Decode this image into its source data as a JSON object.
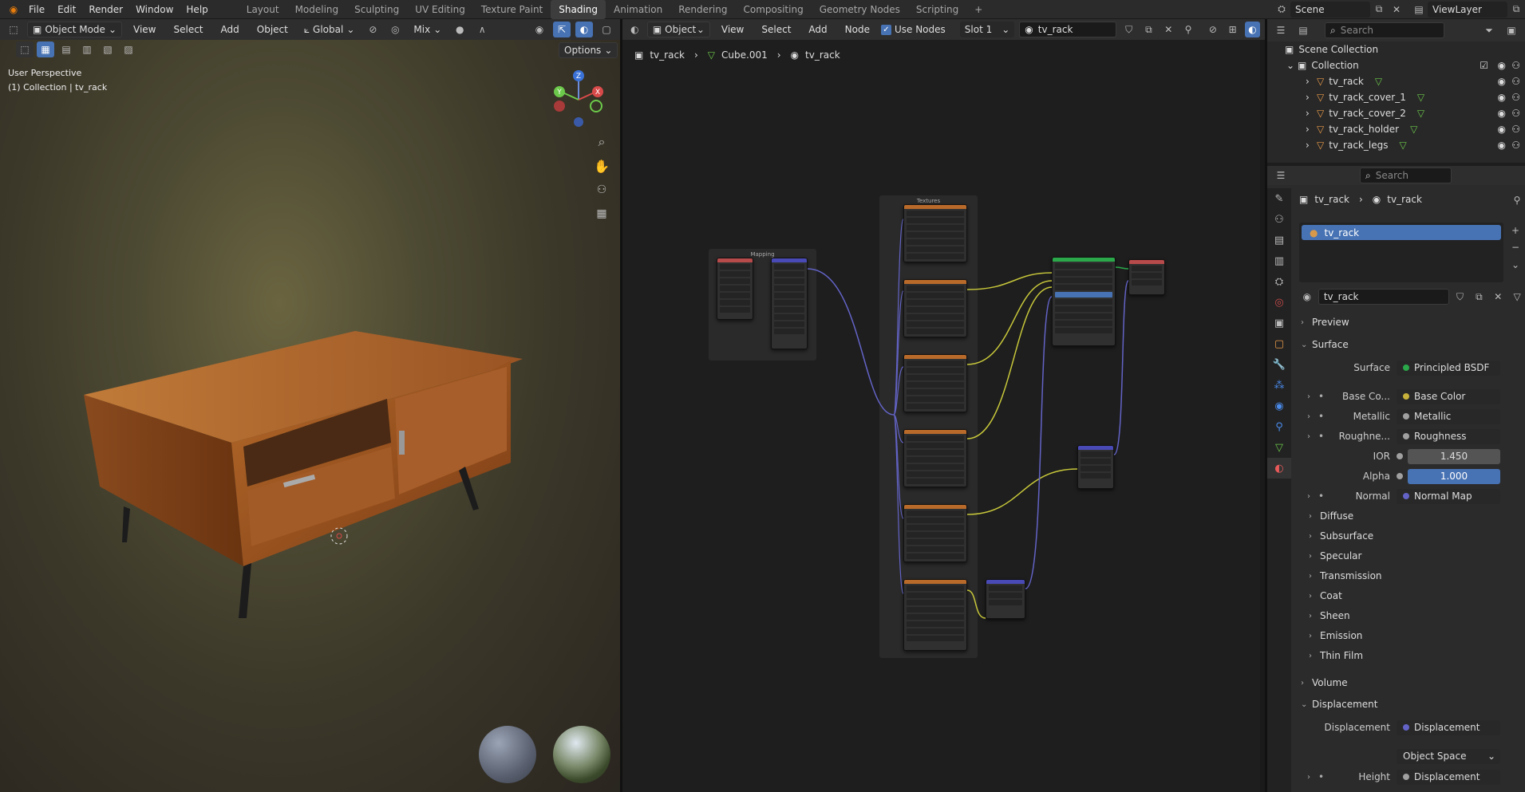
{
  "topbar": {
    "menus": [
      "File",
      "Edit",
      "Render",
      "Window",
      "Help"
    ],
    "workspaces": [
      "Layout",
      "Modeling",
      "Sculpting",
      "UV Editing",
      "Texture Paint",
      "Shading",
      "Animation",
      "Rendering",
      "Compositing",
      "Geometry Nodes",
      "Scripting"
    ],
    "active_workspace": "Shading",
    "add_tab": "+",
    "scene": "Scene",
    "view_layer": "ViewLayer"
  },
  "viewport": {
    "mode": "Object Mode",
    "menus": [
      "View",
      "Select",
      "Add",
      "Object"
    ],
    "transform": "Global",
    "pivot": "Mix",
    "options": "Options",
    "perspective": "User Perspective",
    "collection_info": "(1) Collection | tv_rack",
    "gizmo": {
      "x": "X",
      "y": "Y",
      "z": "Z"
    }
  },
  "node_editor": {
    "type": "Object",
    "menus": [
      "View",
      "Select",
      "Add",
      "Node"
    ],
    "use_nodes_label": "Use Nodes",
    "use_nodes": true,
    "slot": "Slot 1",
    "material": "tv_rack",
    "breadcrumb": [
      "tv_rack",
      "Cube.001",
      "tv_rack"
    ],
    "frames": {
      "mapping": "Mapping",
      "textures": "Textures"
    }
  },
  "outliner": {
    "search_placeholder": "Search",
    "scene_collection": "Scene Collection",
    "collection": "Collection",
    "items": [
      "tv_rack",
      "tv_rack_cover_1",
      "tv_rack_cover_2",
      "tv_rack_holder",
      "tv_rack_legs"
    ]
  },
  "properties": {
    "search_placeholder": "Search",
    "breadcrumb": [
      "tv_rack",
      "tv_rack"
    ],
    "slot_item": "tv_rack",
    "material_name": "tv_rack",
    "preview": "Preview",
    "surface_section": "Surface",
    "surface": {
      "label": "Surface",
      "value": "Principled BSDF"
    },
    "rows": [
      {
        "label": "Base Co...",
        "value": "Base Color",
        "dot": "#c7b13b",
        "expand": true
      },
      {
        "label": "Metallic",
        "value": "Metallic",
        "dot": "#a0a0a0",
        "expand": true
      },
      {
        "label": "Roughne...",
        "value": "Roughness",
        "dot": "#a0a0a0",
        "expand": true
      },
      {
        "label": "IOR",
        "value": "1.450",
        "dot": "#a0a0a0",
        "expand": false,
        "numeric": true
      },
      {
        "label": "Alpha",
        "value": "1.000",
        "dot": "#a0a0a0",
        "expand": false,
        "numeric": true,
        "highlight": true
      },
      {
        "label": "Normal",
        "value": "Normal Map",
        "dot": "#6363c7",
        "expand": true
      }
    ],
    "subsections": [
      "Diffuse",
      "Subsurface",
      "Specular",
      "Transmission",
      "Coat",
      "Sheen",
      "Emission",
      "Thin Film"
    ],
    "volume": "Volume",
    "displacement_section": "Displacement",
    "displacement": {
      "label": "Displacement",
      "value": "Displacement"
    },
    "space": "Object Space",
    "height": {
      "label": "Height",
      "value": "Displacement"
    }
  },
  "colors": {
    "accent": "#4772b3",
    "header": "#2e2e2e",
    "background": "#1d1d1d"
  }
}
